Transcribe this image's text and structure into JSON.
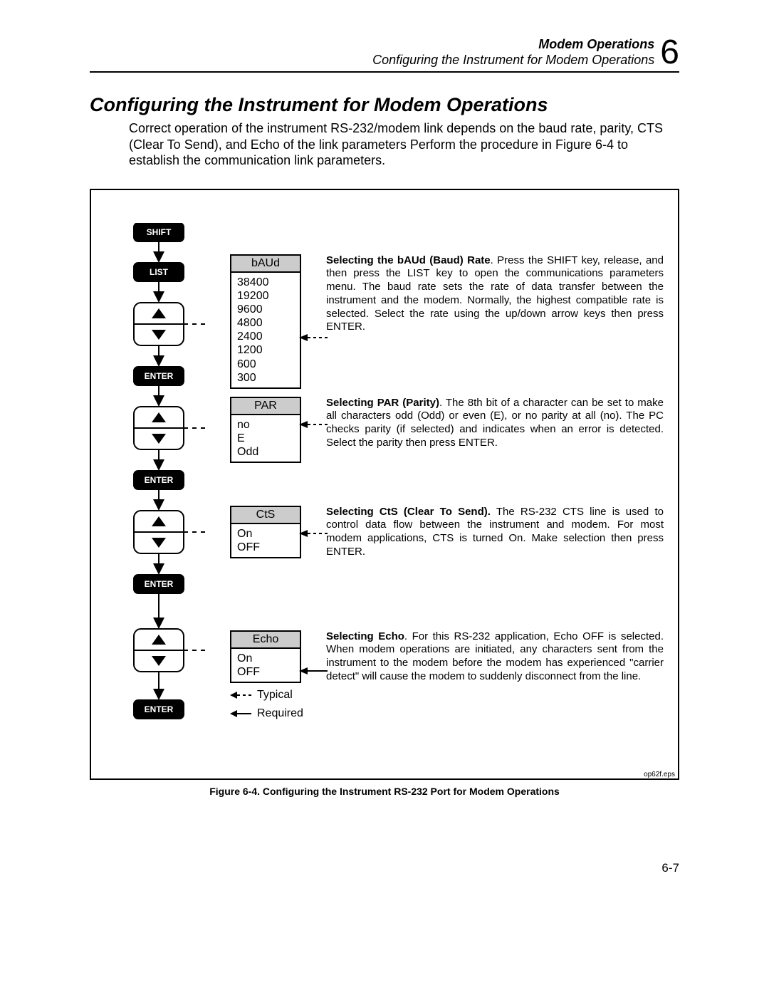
{
  "header": {
    "line1": "Modem Operations",
    "line2": "Configuring the Instrument for Modem Operations",
    "chapter_number": "6"
  },
  "section_title": "Configuring the Instrument for Modem Operations",
  "intro_text": "Correct operation of the instrument RS-232/modem link depends on the baud rate, parity, CTS (Clear To Send), and Echo of the link parameters Perform the procedure in Figure 6-4 to establish the communication link parameters.",
  "figure": {
    "keys": {
      "shift": "SHIFT",
      "list": "LIST",
      "enter": "ENTER"
    },
    "menus": {
      "baud": {
        "title": "bAUd",
        "options": [
          "38400",
          "19200",
          "9600",
          "4800",
          "2400",
          "1200",
          "600",
          "300"
        ],
        "pointer_index": 4
      },
      "par": {
        "title": "PAR",
        "options": [
          "no",
          "E",
          "Odd"
        ],
        "pointer_index": 0
      },
      "cts": {
        "title": "CtS",
        "options": [
          "On",
          "OFF"
        ],
        "pointer_index": 0
      },
      "echo": {
        "title": "Echo",
        "options": [
          "On",
          "OFF"
        ],
        "pointer_index": 1
      }
    },
    "legend": {
      "typical": "Typical",
      "required": "Required"
    },
    "descriptions": {
      "baud": {
        "bold": "Selecting the bAUd (Baud) Rate",
        "text": ".  Press the SHIFT key, release, and then press the LIST key to open the communications parameters menu.  The baud rate sets the rate of data transfer between the instrument and the modem.  Normally, the highest compatible rate is selected.  Select the rate using the up/down arrow keys then press ENTER."
      },
      "par": {
        "bold": "Selecting PAR (Parity)",
        "text": ".   The 8th bit of a character can be set to make all characters odd (Odd) or even (E), or no parity at all (no).  The PC checks parity (if selected) and indicates when an error is detected.  Select the parity then press ENTER."
      },
      "cts": {
        "bold": "Selecting CtS (Clear To Send).",
        "text": "  The RS-232 CTS line is used to control data flow between the instrument and modem.  For most modem applications, CTS is turned On.  Make selection then press ENTER."
      },
      "echo": {
        "bold": "Selecting Echo",
        "text": ".  For this RS-232 application, Echo OFF is selected.  When modem operations are initiated, any characters sent from the instrument to the modem before the modem has experienced \"carrier detect\" will cause the modem to suddenly disconnect from the line."
      }
    },
    "eps_label": "op62f.eps",
    "caption": "Figure 6-4. Configuring the Instrument RS-232 Port for Modem Operations"
  },
  "page_number": "6-7"
}
